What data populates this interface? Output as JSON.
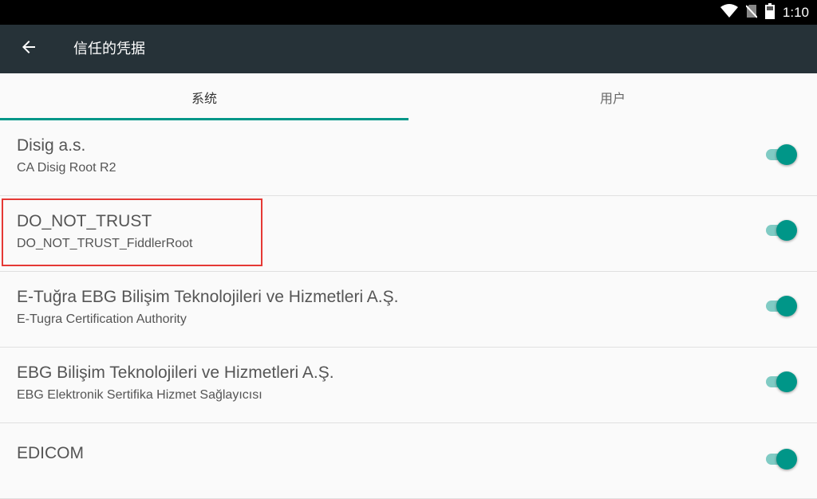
{
  "status_bar": {
    "time": "1:10",
    "icons": [
      "wifi-icon",
      "no-sim-icon",
      "battery-icon"
    ]
  },
  "app_bar": {
    "title": "信任的凭据",
    "back_icon": "arrow-back-icon"
  },
  "tabs": [
    {
      "label": "系统",
      "selected": true
    },
    {
      "label": "用户",
      "selected": false
    }
  ],
  "certificates": [
    {
      "title": "Disig a.s.",
      "subtitle": "CA Disig Root R2",
      "enabled": true
    },
    {
      "title": "DO_NOT_TRUST",
      "subtitle": "DO_NOT_TRUST_FiddlerRoot",
      "enabled": true
    },
    {
      "title": "E-Tuğra EBG Bilişim Teknolojileri ve Hizmetleri A.Ş.",
      "subtitle": "E-Tugra Certification Authority",
      "enabled": true
    },
    {
      "title": "EBG Bilişim Teknolojileri ve Hizmetleri A.Ş.",
      "subtitle": "EBG Elektronik Sertifika Hizmet Sağlayıcısı",
      "enabled": true
    },
    {
      "title": "EDICOM",
      "subtitle": "",
      "enabled": true
    }
  ],
  "colors": {
    "accent": "#009688",
    "app_bar": "#263238",
    "highlight_box": "#e53935"
  }
}
